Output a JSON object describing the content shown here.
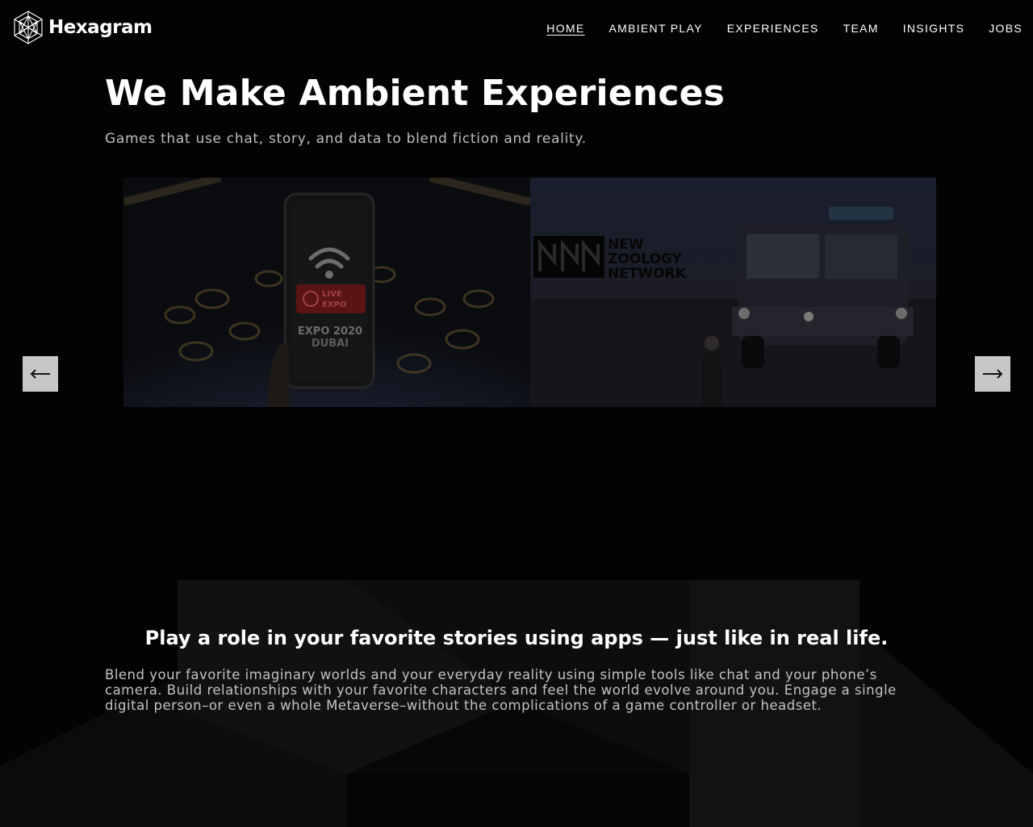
{
  "header": {
    "brand": "Hexagram",
    "nav": [
      {
        "label": "HOME",
        "active": true
      },
      {
        "label": "AMBIENT PLAY",
        "active": false
      },
      {
        "label": "EXPERIENCES",
        "active": false
      },
      {
        "label": "TEAM",
        "active": false
      },
      {
        "label": "INSIGHTS",
        "active": false
      },
      {
        "label": "JOBS",
        "active": false
      }
    ]
  },
  "hero": {
    "title": "We Make Ambient Experiences",
    "subtitle": "Games that use chat, story, and data to blend fiction and reality."
  },
  "carousel": {
    "slides": [
      {
        "image": "expo-2020-dubai-phone",
        "phone_badge": "LIVE EXPO",
        "caption": "EXPO 2020 DUBAI"
      },
      {
        "image": "new-zoology-network-van",
        "logo": "NZN",
        "caption": "NEW ZOOLOGY NETWORK"
      }
    ],
    "prev_icon": "arrow-left-icon",
    "next_icon": "arrow-right-icon"
  },
  "feature": {
    "title": "Play a role in your favorite stories using apps — just like in real life.",
    "body": "Blend your favorite imaginary worlds and your everyday reality using simple tools like chat and your phone’s camera. Build relationships with your favorite characters and feel the world evolve around you. Engage a single digital person–or even a whole Metaverse–without the complications of a game controller or headset."
  },
  "colors": {
    "background": "#030303",
    "text": "#ffffff",
    "muted_text": "#bdbdbd",
    "arrow_button": "#c7c7c7"
  }
}
